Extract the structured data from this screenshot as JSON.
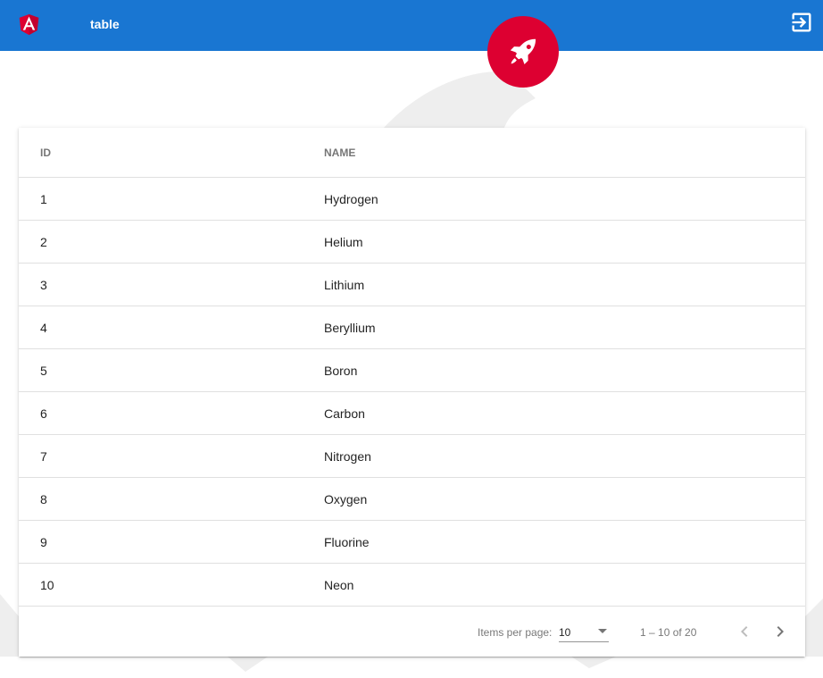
{
  "toolbar": {
    "title": "table",
    "logo_icon": "angular-logo",
    "logout_icon": "logout-icon",
    "color": "#1976d2"
  },
  "fab": {
    "icon": "rocket-icon",
    "color": "#dd0031"
  },
  "table": {
    "columns": [
      "ID",
      "NAME"
    ],
    "rows": [
      {
        "id": "1",
        "name": "Hydrogen"
      },
      {
        "id": "2",
        "name": "Helium"
      },
      {
        "id": "3",
        "name": "Lithium"
      },
      {
        "id": "4",
        "name": "Beryllium"
      },
      {
        "id": "5",
        "name": "Boron"
      },
      {
        "id": "6",
        "name": "Carbon"
      },
      {
        "id": "7",
        "name": "Nitrogen"
      },
      {
        "id": "8",
        "name": "Oxygen"
      },
      {
        "id": "9",
        "name": "Fluorine"
      },
      {
        "id": "10",
        "name": "Neon"
      }
    ]
  },
  "paginator": {
    "items_per_page_label": "Items per page:",
    "page_size": "10",
    "range_label": "1 – 10 of 20",
    "prev_icon": "chevron-left-icon",
    "next_icon": "chevron-right-icon"
  }
}
